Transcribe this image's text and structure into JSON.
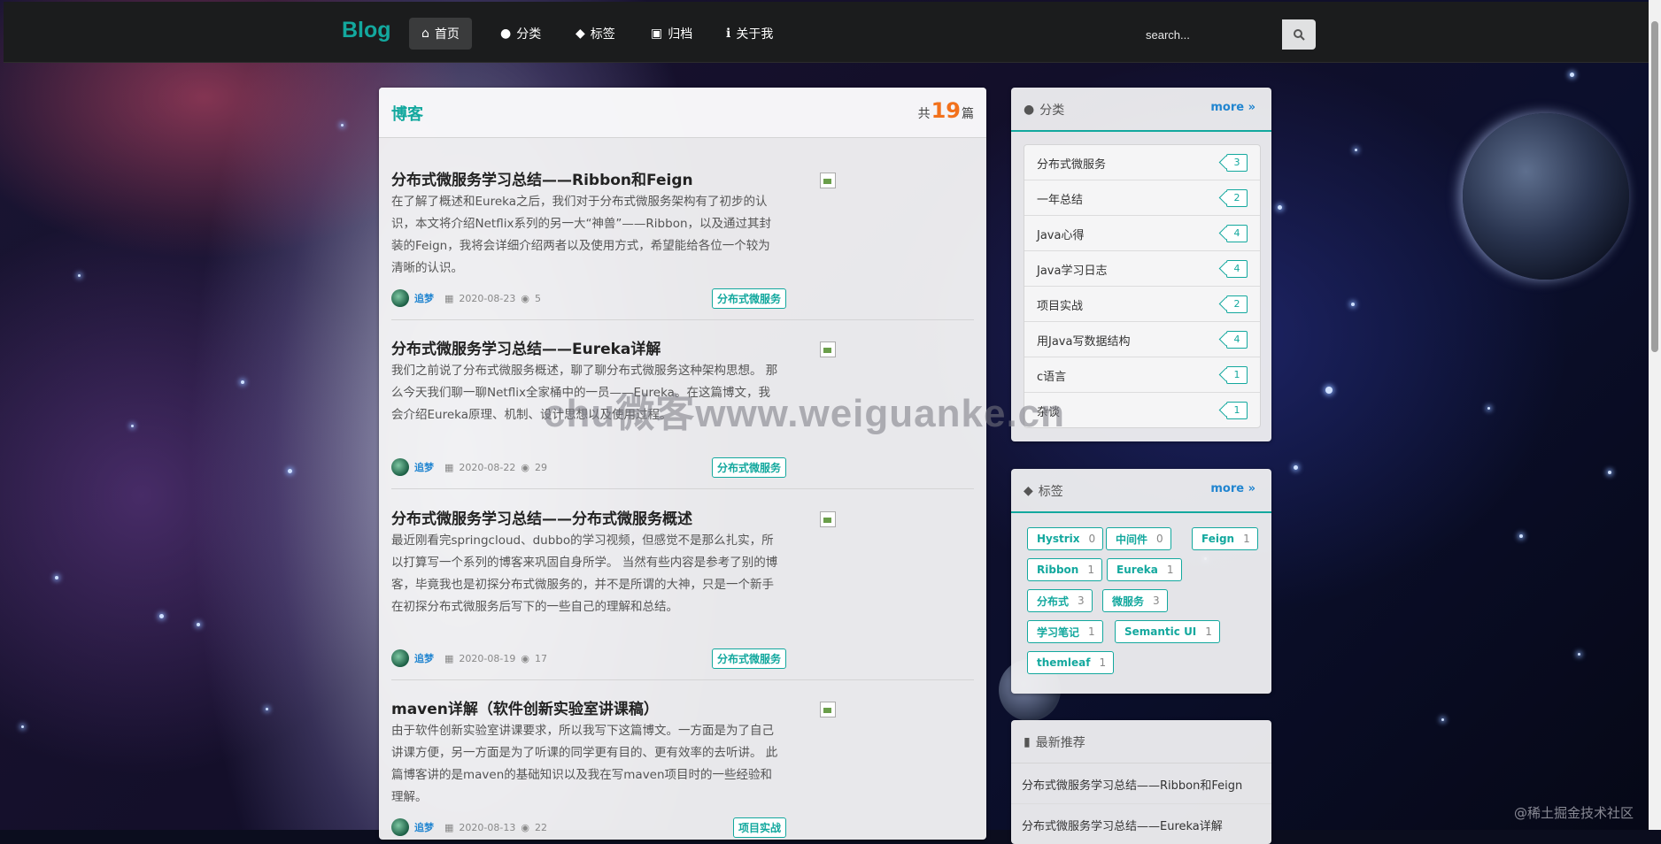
{
  "nav": {
    "brand": "Blog",
    "items": [
      {
        "label": "首页",
        "icon": "home-icon"
      },
      {
        "label": "分类",
        "icon": "lightbulb-icon"
      },
      {
        "label": "标签",
        "icon": "tags-icon"
      },
      {
        "label": "归档",
        "icon": "clone-icon"
      },
      {
        "label": "关于我",
        "icon": "info-icon"
      }
    ],
    "search_placeholder": "search...",
    "active_item": "首页"
  },
  "main": {
    "title": "博客",
    "count_prefix": "共",
    "count": "19",
    "count_suffix": "篇",
    "posts": [
      {
        "title": "分布式微服务学习总结——Ribbon和Feign",
        "summary": "在了解了概述和Eureka之后，我们对于分布式微服务架构有了初步的认识，本文将介绍Netflix系列的另一大“神兽”——Ribbon，以及通过其封装的Feign，我将会详细介绍两者以及使用方式，希望能给各位一个较为清晰的认识。",
        "author": "追梦",
        "date": "2020-08-23",
        "views": "5",
        "category": "分布式微服务"
      },
      {
        "title": "分布式微服务学习总结——Eureka详解",
        "summary": "我们之前说了分布式微服务概述，聊了聊分布式微服务这种架构思想。 那么今天我们聊一聊Netflix全家桶中的一员——Eureka。在这篇博文，我会介绍Eureka原理、机制、设计思想以及使用过程。",
        "author": "追梦",
        "date": "2020-08-22",
        "views": "29",
        "category": "分布式微服务"
      },
      {
        "title": "分布式微服务学习总结——分布式微服务概述",
        "summary": "最近刚看完springcloud、dubbo的学习视频，但感觉不是那么扎实，所以打算写一个系列的博客来巩固自身所学。 当然有些内容是参考了别的博客，毕竟我也是初探分布式微服务的，并不是所谓的大神，只是一个新手在初探分布式微服务后写下的一些自己的理解和总结。",
        "author": "追梦",
        "date": "2020-08-19",
        "views": "17",
        "category": "分布式微服务"
      },
      {
        "title": "maven详解（软件创新实验室讲课稿）",
        "summary": "由于软件创新实验室讲课要求，所以我写下这篇博文。一方面是为了自己讲课方便，另一方面是为了听课的同学更有目的、更有效率的去听讲。 此篇博客讲的是maven的基础知识以及我在写maven项目时的一些经验和理解。",
        "author": "追梦",
        "date": "2020-08-13",
        "views": "22",
        "category": "项目实战"
      }
    ]
  },
  "categories": {
    "title": "分类",
    "more": "more",
    "items": [
      {
        "name": "分布式微服务",
        "count": "3"
      },
      {
        "name": "一年总结",
        "count": "2"
      },
      {
        "name": "Java心得",
        "count": "4"
      },
      {
        "name": "Java学习日志",
        "count": "4"
      },
      {
        "name": "项目实战",
        "count": "2"
      },
      {
        "name": "用Java写数据结构",
        "count": "4"
      },
      {
        "name": "c语言",
        "count": "1"
      },
      {
        "name": "杂谈",
        "count": "1"
      }
    ]
  },
  "tags": {
    "title": "标签",
    "more": "more",
    "items": [
      {
        "name": "Hystrix",
        "count": "0"
      },
      {
        "name": "中间件",
        "count": "0"
      },
      {
        "name": "Feign",
        "count": "1"
      },
      {
        "name": "Ribbon",
        "count": "1"
      },
      {
        "name": "Eureka",
        "count": "1"
      },
      {
        "name": "分布式",
        "count": "3"
      },
      {
        "name": "微服务",
        "count": "3"
      },
      {
        "name": "学习笔记",
        "count": "1"
      },
      {
        "name": "Semantic UI",
        "count": "1"
      },
      {
        "name": "themleaf",
        "count": "1"
      }
    ]
  },
  "recommend": {
    "title": "最新推荐",
    "items": [
      "分布式微服务学习总结——Ribbon和Feign",
      "分布式微服务学习总结——Eureka详解"
    ]
  },
  "watermark": "chu微客www.weiguanke.cn",
  "credit": "@稀土掘金技术社区",
  "colors": {
    "accent": "#13a89e",
    "count": "#f2711c",
    "link": "#2185d0",
    "topbar": "#1b1c1d"
  }
}
